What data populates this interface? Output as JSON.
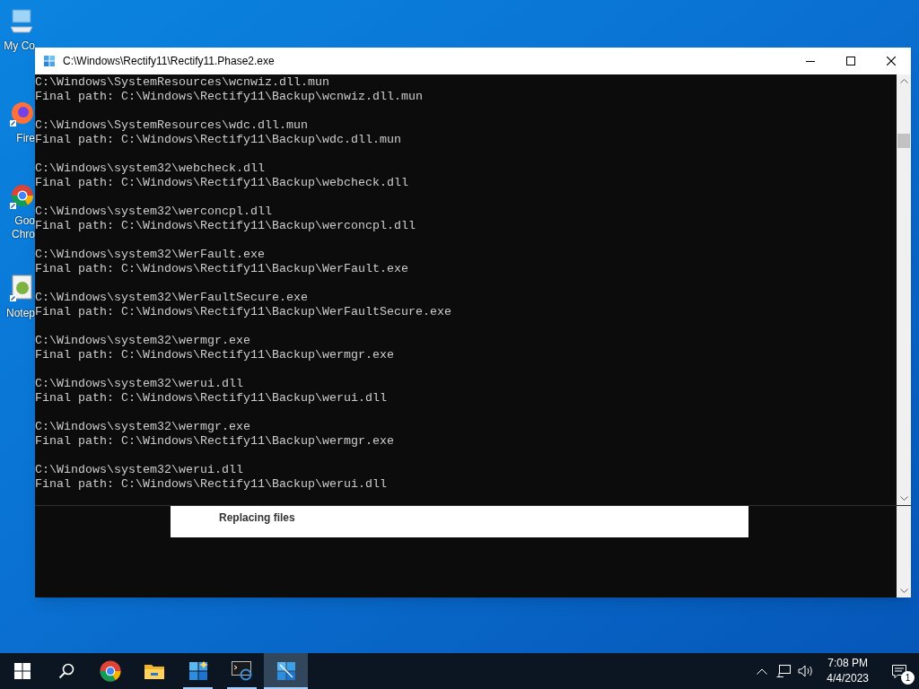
{
  "desktop_icons": [
    {
      "kind": "computer",
      "label": "My Co"
    },
    {
      "kind": "firefox",
      "label": "Fire"
    },
    {
      "kind": "chrome",
      "label": "Goo Chro"
    },
    {
      "kind": "notepad",
      "label": "Notep"
    }
  ],
  "window": {
    "title": "C:\\Windows\\Rectify11\\Rectify11.Phase2.exe",
    "entries": [
      {
        "source": "C:\\Windows\\SystemResources\\wcnwiz.dll.mun",
        "final": "Final path: C:\\Windows\\Rectify11\\Backup\\wcnwiz.dll.mun"
      },
      {
        "source": "C:\\Windows\\SystemResources\\wdc.dll.mun",
        "final": "Final path: C:\\Windows\\Rectify11\\Backup\\wdc.dll.mun"
      },
      {
        "source": "C:\\Windows\\system32\\webcheck.dll",
        "final": "Final path: C:\\Windows\\Rectify11\\Backup\\webcheck.dll"
      },
      {
        "source": "C:\\Windows\\system32\\werconcpl.dll",
        "final": "Final path: C:\\Windows\\Rectify11\\Backup\\werconcpl.dll"
      },
      {
        "source": "C:\\Windows\\system32\\WerFault.exe",
        "final": "Final path: C:\\Windows\\Rectify11\\Backup\\WerFault.exe"
      },
      {
        "source": "C:\\Windows\\system32\\WerFaultSecure.exe",
        "final": "Final path: C:\\Windows\\Rectify11\\Backup\\WerFaultSecure.exe"
      },
      {
        "source": "C:\\Windows\\system32\\wermgr.exe",
        "final": "Final path: C:\\Windows\\Rectify11\\Backup\\wermgr.exe"
      },
      {
        "source": "C:\\Windows\\system32\\werui.dll",
        "final": "Final path: C:\\Windows\\Rectify11\\Backup\\werui.dll"
      },
      {
        "source": "C:\\Windows\\system32\\wermgr.exe",
        "final": "Final path: C:\\Windows\\Rectify11\\Backup\\wermgr.exe"
      },
      {
        "source": "C:\\Windows\\system32\\werui.dll",
        "final": "Final path: C:\\Windows\\Rectify11\\Backup\\werui.dll"
      }
    ],
    "dialog": {
      "text": "Replacing files"
    }
  },
  "taskbar": {
    "items": [
      {
        "kind": "start",
        "running": false,
        "selected": false
      },
      {
        "kind": "search",
        "running": false,
        "selected": false
      },
      {
        "kind": "chrome",
        "running": false,
        "selected": false
      },
      {
        "kind": "explorer",
        "running": false,
        "selected": false
      },
      {
        "kind": "rectify",
        "running": true,
        "selected": false
      },
      {
        "kind": "console",
        "running": true,
        "selected": false
      },
      {
        "kind": "app",
        "running": true,
        "selected": true
      }
    ],
    "clock": {
      "time": "7:08 PM",
      "date": "4/4/2023"
    },
    "notifications": {
      "badge": "1"
    }
  }
}
